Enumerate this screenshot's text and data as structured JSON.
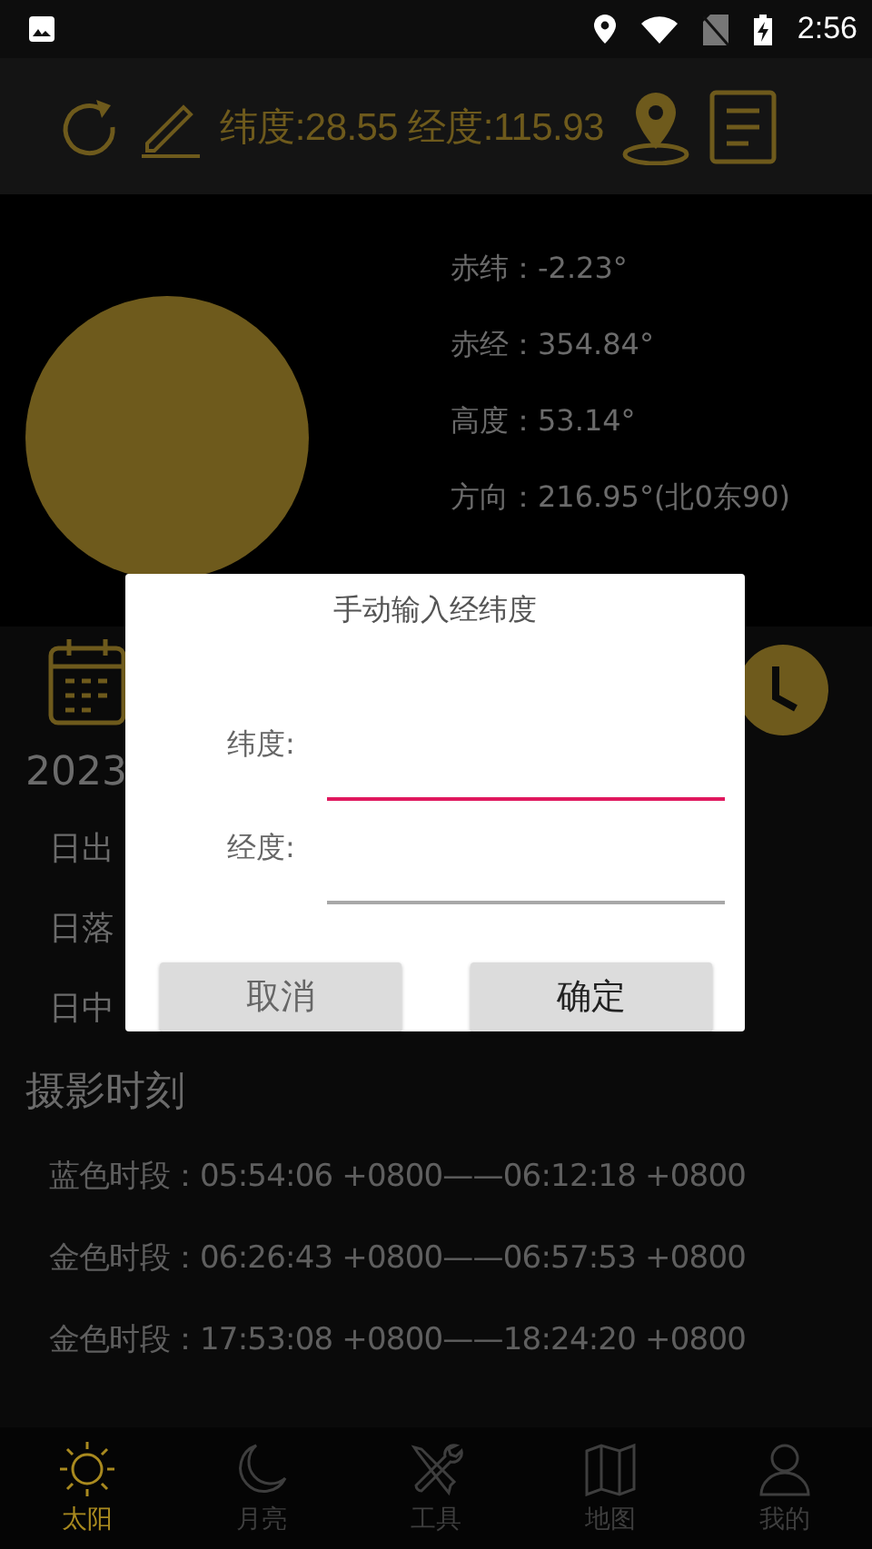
{
  "status_bar": {
    "time": "2:56"
  },
  "toolbar": {
    "coordinates": "纬度:28.55 经度:115.93"
  },
  "sun_info": [
    "赤纬：-2.23°",
    "赤经：354.84°",
    "高度：53.14°",
    "方向：216.95°(北0东90)"
  ],
  "date": "2023",
  "sun_events": [
    "日出",
    "日落",
    "日中"
  ],
  "photo_section": {
    "title": "摄影时刻",
    "rows": [
      {
        "text": "蓝色时段：05:54:06 +0800——06:12:18 +0800"
      },
      {
        "text": "金色时段：06:26:43 +0800——06:57:53 +0800"
      },
      {
        "text": "金色时段：17:53:08 +0800——18:24:20 +0800"
      }
    ]
  },
  "dialog": {
    "title": "手动输入经纬度",
    "fields": [
      {
        "label": "纬度:",
        "focused": true
      },
      {
        "label": "经度:",
        "focused": false
      }
    ],
    "buttons": [
      "取消",
      "确定"
    ]
  },
  "bottom_nav": [
    {
      "kind": "sun",
      "label": "太阳",
      "selected": true
    },
    {
      "kind": "moon",
      "label": "月亮",
      "selected": false
    },
    {
      "kind": "tools",
      "label": "工具",
      "selected": false
    },
    {
      "kind": "map",
      "label": "地图",
      "selected": false
    },
    {
      "kind": "person",
      "label": "我的",
      "selected": false
    }
  ]
}
